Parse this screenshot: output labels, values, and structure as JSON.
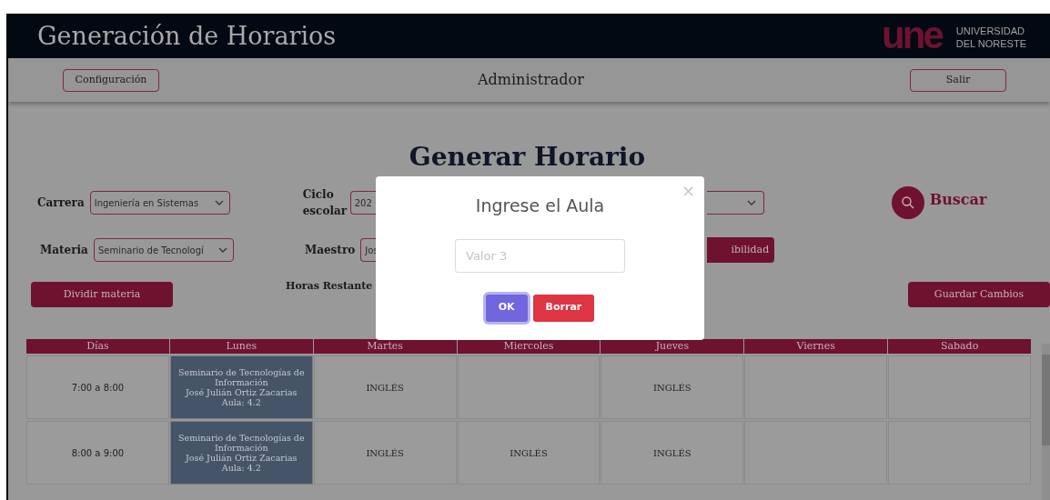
{
  "header": {
    "title": "Generación de Horarios",
    "logo_mark": "une",
    "logo_lines": [
      "UNIVERSIDAD",
      "DEL NORESTE"
    ]
  },
  "nav": {
    "left_button": "Configuración",
    "role": "Administrador",
    "right_button": "Salir"
  },
  "page_title": "Generar Horario",
  "row_1": [
    {
      "kind": "select",
      "label": "Carrera",
      "value": "Ingeniería en Sistemas"
    },
    {
      "kind": "select",
      "label": "Ciclo escolar",
      "value": "202"
    },
    {
      "kind": "select_right"
    },
    {
      "kind": "search",
      "label": "Buscar"
    }
  ],
  "row_2": [
    {
      "kind": "select",
      "label": "Materia",
      "value": "Seminario de Tecnologí"
    },
    {
      "kind": "select",
      "label": "Maestro",
      "value": "Jos"
    },
    {
      "kind": "button",
      "label": "ibilidad"
    }
  ],
  "row_3": {
    "left_button": "Dividir materia",
    "hours_label": "Horas Restante",
    "right_button": "Guardar Cambios"
  },
  "table": {
    "columns": [
      "Días",
      "Lunes",
      "Martes",
      "Miercoles",
      "Jueves",
      "Viernes",
      "Sabado"
    ],
    "rows": [
      {
        "cells": [
          {
            "kind": "time",
            "lines": [
              "7:00 a 8:00"
            ]
          },
          {
            "kind": "class",
            "lines": [
              "Seminario de Tecnologías de Información",
              "José Julián Ortiz Zacarias",
              "Aula: 4.2"
            ]
          },
          {
            "kind": "text",
            "lines": [
              "INGLÉS"
            ]
          },
          {
            "kind": "empty"
          },
          {
            "kind": "text",
            "lines": [
              "INGLÉS"
            ]
          },
          {
            "kind": "empty"
          },
          {
            "kind": "empty"
          }
        ]
      },
      {
        "cells": [
          {
            "kind": "time",
            "lines": [
              "8:00 a 9:00"
            ]
          },
          {
            "kind": "class",
            "lines": [
              "Seminario de Tecnologías de Información",
              "José Julián Ortiz Zacarias",
              "Aula: 4.2"
            ]
          },
          {
            "kind": "text",
            "lines": [
              "INGLÉS"
            ]
          },
          {
            "kind": "text",
            "lines": [
              "INGLÉS"
            ]
          },
          {
            "kind": "text",
            "lines": [
              "INGLÉS"
            ]
          },
          {
            "kind": "empty"
          },
          {
            "kind": "empty"
          }
        ]
      }
    ]
  },
  "modal": {
    "title": "Ingrese el Aula",
    "close": "×",
    "placeholder": "Valor 3",
    "buttons": [
      {
        "kind": "primary",
        "label": "OK",
        "focused": true
      },
      {
        "kind": "danger",
        "label": "Borrar",
        "focused": false
      }
    ]
  }
}
